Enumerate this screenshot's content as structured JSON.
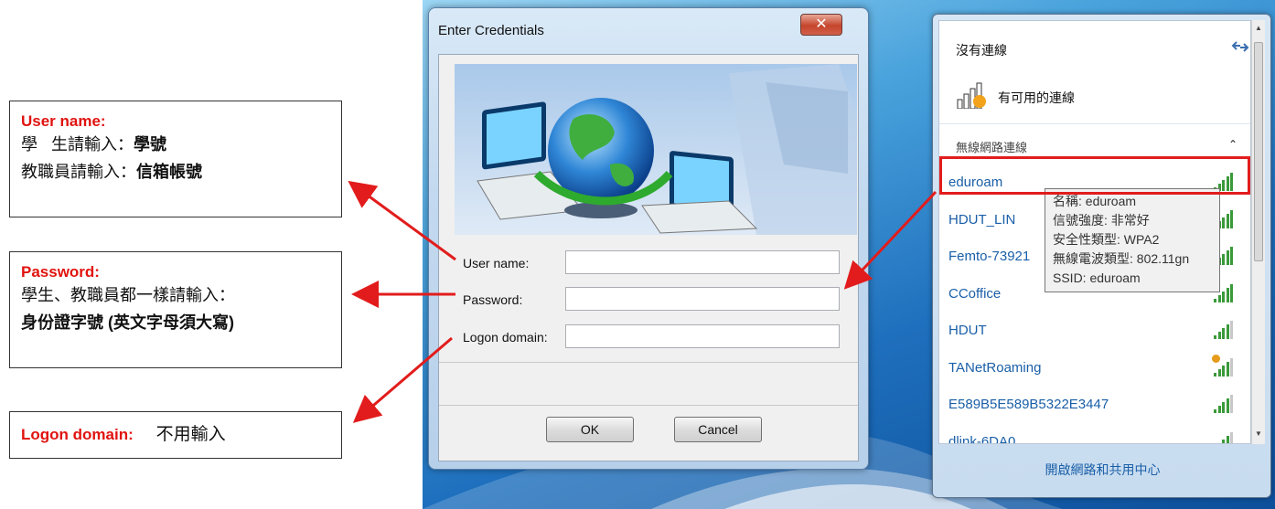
{
  "annotations": {
    "user_name": {
      "title": "User name:",
      "line1_a": "學",
      "line1_b": "生請輸入：",
      "line1_c": "學號",
      "line2_a": "教職員請輸入：",
      "line2_b": "信箱帳號"
    },
    "password": {
      "title": "Password:",
      "line1": "學生、教職員都一樣請輸入：",
      "line2": "身份證字號 (英文字母須大寫)"
    },
    "logon_domain": {
      "title": "Logon domain:",
      "text": "不用輸入"
    }
  },
  "dialog": {
    "title": "Enter Credentials",
    "close_glyph": "✕",
    "fields": {
      "user_name_label": "User name:",
      "password_label": "Password:",
      "domain_label": "Logon domain:",
      "user_name_value": "",
      "password_value": "",
      "domain_value": ""
    },
    "ok_label": "OK",
    "cancel_label": "Cancel"
  },
  "network_panel": {
    "status": "沒有連線",
    "available": "有可用的連線",
    "section": "無線網路連線",
    "networks": [
      "eduroam",
      "HDUT_LIN",
      "Femto-73921",
      "CCoffice",
      "HDUT",
      "TANetRoaming",
      "E589B5E589B5322E3447",
      "dlink-6DA0"
    ],
    "footer_link": "開啟網路和共用中心",
    "tooltip": {
      "name": "名稱: eduroam",
      "signal": "信號強度: 非常好",
      "security": "安全性類型: WPA2",
      "radio": "無線電波類型: 802.11gn",
      "ssid": "SSID: eduroam"
    }
  },
  "colors": {
    "accent_red": "#e21c1c",
    "link_blue": "#1a5fa8"
  }
}
